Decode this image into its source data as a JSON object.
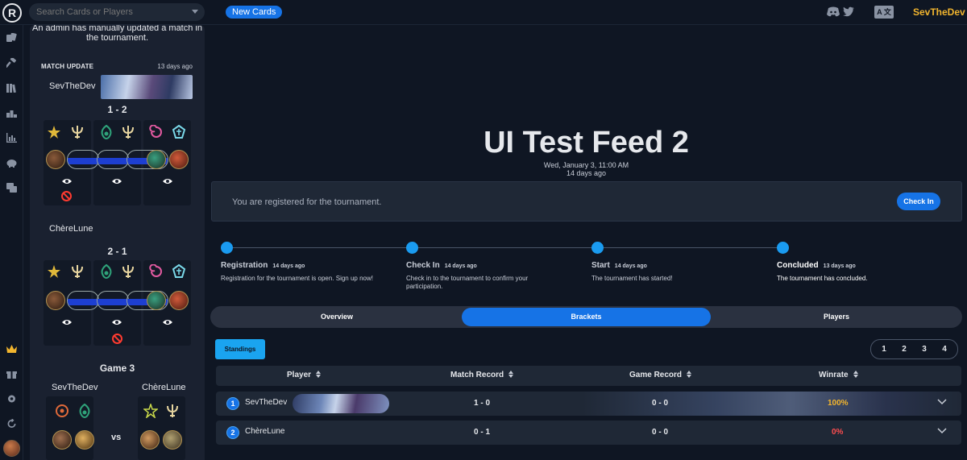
{
  "topbar": {
    "logo_text": "R",
    "search_placeholder": "Search Cards or Players",
    "new_cards_label": "New Cards",
    "translate_label": "A 文",
    "user_name": "SevTheDev",
    "icons": [
      "discord-icon",
      "twitter-icon",
      "translate-icon",
      "chevron-down-icon"
    ]
  },
  "sidebar": {
    "icons": [
      "cards-icon",
      "hammer-icon",
      "library-icon",
      "podium-icon",
      "stats-chart-icon",
      "piggy-bank-icon",
      "cards-stack-icon",
      "crown-icon",
      "gift-icon",
      "gear-icon",
      "refresh-icon",
      "avatar"
    ]
  },
  "feed": {
    "top_note": "An admin has manually updated a match in the tournament.",
    "match_update_label": "MATCH UPDATE",
    "match_update_time": "13 days ago",
    "game1": {
      "player": "SevTheDev",
      "score": "1 - 2"
    },
    "game2": {
      "player": "ChèreLune",
      "score": "2 - 1"
    },
    "game3": {
      "label": "Game 3",
      "player1": "SevTheDev",
      "player2": "ChèreLune",
      "vs": "vs"
    }
  },
  "main": {
    "title": "UI Test Feed 2",
    "date": "Wed, January 3, 11:00 AM",
    "ago": "14 days ago",
    "registration_text": "You are registered for the tournament.",
    "checkin_button": "Check In",
    "steps": [
      {
        "title": "Registration",
        "time": "14 days ago",
        "desc": "Registration for the tournament is open. Sign up now!"
      },
      {
        "title": "Check In",
        "time": "14 days ago",
        "desc": "Check in to the tournament to confirm your participation."
      },
      {
        "title": "Start",
        "time": "14 days ago",
        "desc": "The tournament has started!"
      },
      {
        "title": "Concluded",
        "time": "13 days ago",
        "desc": "The tournament has concluded."
      }
    ],
    "tabs": [
      "Overview",
      "Brackets",
      "Players"
    ],
    "active_tab": "Brackets",
    "standings_label": "Standings",
    "pages": [
      "1",
      "2",
      "3",
      "4"
    ],
    "table": {
      "headers": [
        "Player",
        "Match Record",
        "Game Record",
        "Winrate"
      ],
      "rows": [
        {
          "rank": "1",
          "player": "SevTheDev",
          "match_record": "1 - 0",
          "game_record": "0 - 0",
          "winrate": "100%",
          "winrate_color": "#f2b52e"
        },
        {
          "rank": "2",
          "player": "ChèreLune",
          "match_record": "0 - 1",
          "game_record": "0 - 0",
          "winrate": "0%",
          "winrate_color": "#ff4d4f"
        }
      ]
    }
  },
  "colors": {
    "accent": "#1673e6",
    "gold": "#f2b52e",
    "step_dot": "#1a9bf0",
    "danger": "#ff4d4f"
  }
}
